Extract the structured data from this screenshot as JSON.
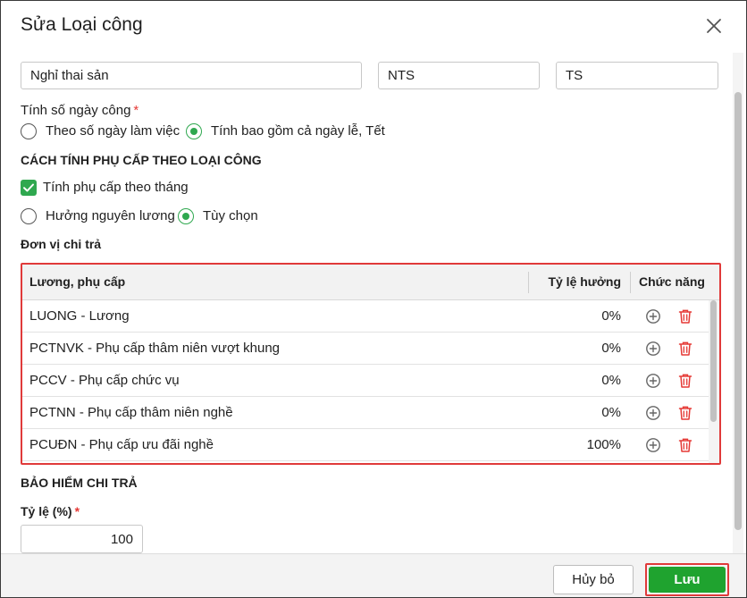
{
  "dialog": {
    "title": "Sửa Loại công"
  },
  "fields": {
    "name_value": "Nghỉ thai sản",
    "code_value": "NTS",
    "symbol_value": "TS"
  },
  "workday_calc": {
    "label": "Tính số ngày công",
    "required_mark": "*",
    "options": [
      {
        "label": "Theo số ngày làm việc",
        "selected": false
      },
      {
        "label": "Tính bao gồm cả ngày lễ, Tết",
        "selected": true
      }
    ]
  },
  "allowance_section": {
    "heading": "CÁCH TÍNH PHỤ CẤP THEO LOẠI CÔNG",
    "monthly_checkbox_label": "Tính phụ cấp theo tháng",
    "monthly_checked": true,
    "options": [
      {
        "label": "Hưởng nguyên lương",
        "selected": false
      },
      {
        "label": "Tùy chọn",
        "selected": true
      }
    ]
  },
  "payer": {
    "label": "Đơn vị chi trả"
  },
  "grid": {
    "columns": [
      "Lương, phụ cấp",
      "Tỷ lệ hưởng",
      "Chức năng"
    ],
    "rows": [
      {
        "name": "LUONG - Lương",
        "rate": "0%"
      },
      {
        "name": "PCTNVK - Phụ cấp thâm niên vượt khung",
        "rate": "0%"
      },
      {
        "name": "PCCV - Phụ cấp chức vụ",
        "rate": "0%"
      },
      {
        "name": "PCTNN - Phụ cấp thâm niên nghề",
        "rate": "0%"
      },
      {
        "name": "PCUĐN - Phụ cấp ưu đãi nghề",
        "rate": "100%"
      }
    ]
  },
  "insurance": {
    "heading": "BẢO HIỂM CHI TRẢ",
    "rate_label": "Tỷ lệ (%)",
    "required_mark": "*",
    "rate_value": "100"
  },
  "footer": {
    "cancel_label": "Hủy bỏ",
    "save_label": "Lưu"
  },
  "colors": {
    "accent_green": "#2fa84f",
    "save_button": "#1fa32f",
    "highlight_red": "#e03a3a",
    "delete_icon_red": "#e53935"
  },
  "icons": {
    "close": "close-icon",
    "add": "add-circle-icon",
    "delete": "trash-icon",
    "check": "check-icon"
  }
}
